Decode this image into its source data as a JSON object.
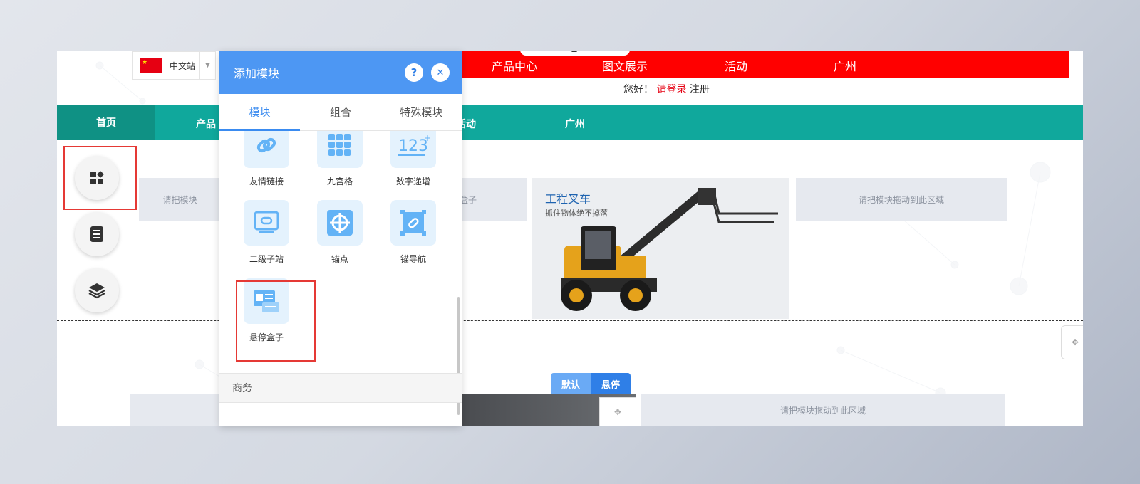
{
  "site": {
    "top_nav": [
      "产品中心",
      "图文展示",
      "活动",
      "广州"
    ],
    "language": {
      "label": "中文站"
    },
    "greeting": {
      "hello": "您好！",
      "login": "请登录",
      "register": "注册"
    },
    "main_nav": [
      "首页",
      "产品",
      "活动",
      "广州"
    ],
    "drop_zone_text": "请把模块拖动到此区域",
    "drop_zone_partial_left": "请把模块",
    "drop_zone_partial_mid": "盒子",
    "forklift": {
      "title": "工程叉车",
      "subtitle": "抓住物体绝不掉落"
    },
    "state_tabs": {
      "default": "默认",
      "hover": "悬停"
    }
  },
  "panel": {
    "title": "添加模块",
    "help": "?",
    "close": "✕",
    "tabs": [
      "模块",
      "组合",
      "特殊模块"
    ],
    "active_tab": "模块",
    "modules": [
      {
        "label": "友情链接",
        "icon": "link-icon"
      },
      {
        "label": "九宫格",
        "icon": "grid-icon"
      },
      {
        "label": "数字递增",
        "icon": "number-123-icon"
      },
      {
        "label": "二级子站",
        "icon": "subsite-icon"
      },
      {
        "label": "锚点",
        "icon": "anchor-target-icon"
      },
      {
        "label": "锚导航",
        "icon": "anchor-nav-icon"
      },
      {
        "label": "悬停盒子",
        "icon": "hover-box-icon"
      }
    ],
    "section": "商务"
  },
  "colors": {
    "accent": "#4d97f3",
    "red_nav": "#ff0000",
    "green_nav": "#10a89c",
    "highlight": "#e53935"
  }
}
